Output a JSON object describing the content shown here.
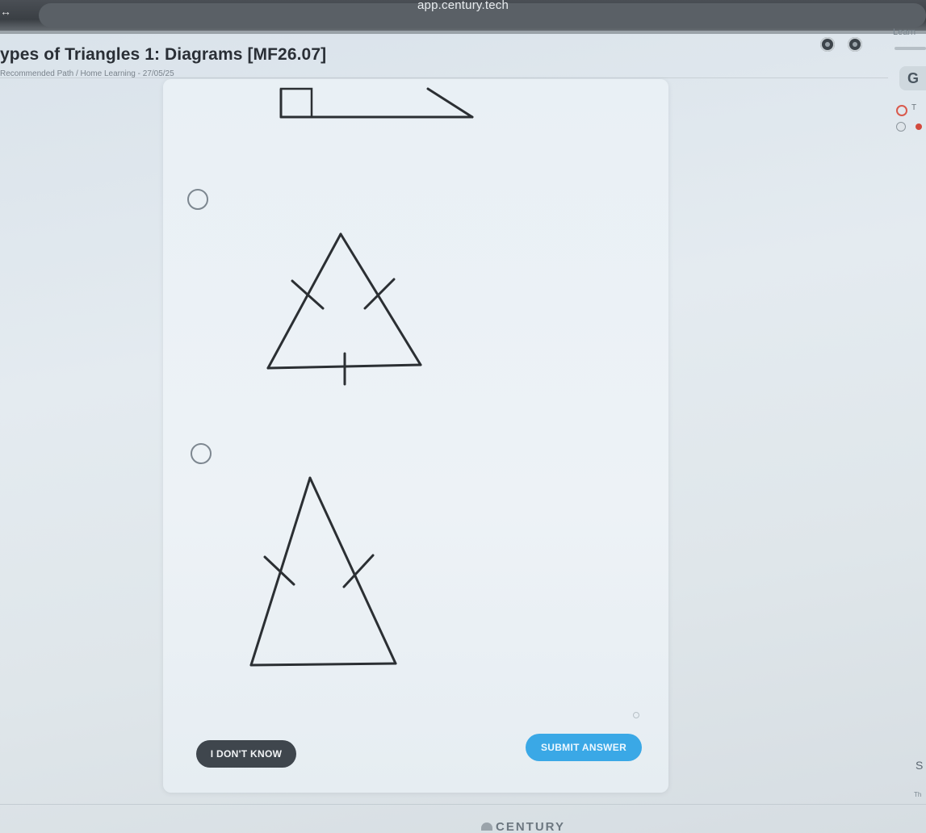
{
  "browser": {
    "url": "app.century.tech",
    "tab_glyph": "↔"
  },
  "header": {
    "title": "ypes of Triangles 1: Diagrams [MF26.07]",
    "breadcrumb": "Recommended Path  /  Home Learning - 27/05/25"
  },
  "side_panel": {
    "learn_label": "Learn",
    "avatar_glyph": "G",
    "ring_label": "T",
    "s_fragment": "S",
    "t_fragment": "Th"
  },
  "question": {
    "options": [
      {
        "id": "option-a",
        "diagram": "right-triangle-partial"
      },
      {
        "id": "option-b",
        "diagram": "equilateral-triangle"
      },
      {
        "id": "option-c",
        "diagram": "isosceles-triangle"
      }
    ]
  },
  "actions": {
    "dont_know_label": "I DON'T KNOW",
    "submit_label": "SUBMIT ANSWER"
  },
  "footer": {
    "logo_text": "CENTURY"
  },
  "colors": {
    "submit_blue": "#3aa8e6",
    "dont_know_dark": "#3f464d",
    "accent_red": "#d24a3e"
  }
}
